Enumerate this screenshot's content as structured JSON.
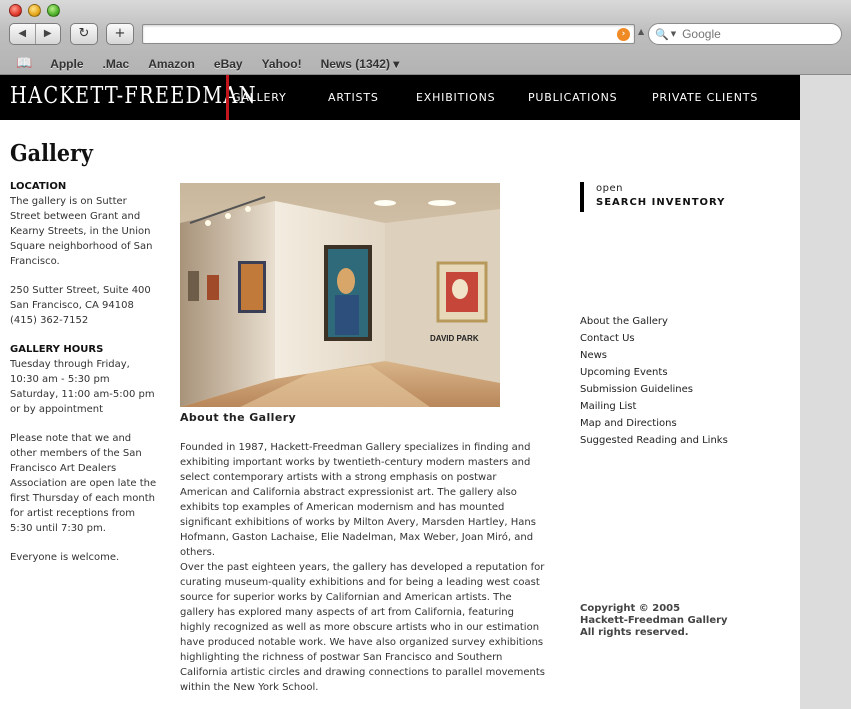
{
  "browser": {
    "bookmarks": [
      "Apple",
      ".Mac",
      "Amazon",
      "eBay",
      "Yahoo!",
      "News (1342) ▾"
    ],
    "search_placeholder": "Google",
    "url": ""
  },
  "site": {
    "logo": "HACKETT-FREEDMAN",
    "nav": [
      "GALLERY",
      "ARTISTS",
      "EXHIBITIONS",
      "PUBLICATIONS",
      "PRIVATE CLIENTS"
    ]
  },
  "page_title": "Gallery",
  "left": {
    "location_heading": "LOCATION",
    "location_text": "The gallery is on Sutter Street between Grant and Kearny Streets, in the Union Square neighborhood of San Francisco.",
    "address_line1": "250 Sutter Street, Suite 400",
    "address_line2": "San Francisco, CA 94108",
    "phone": "(415) 362-7152",
    "hours_heading": "GALLERY HOURS",
    "hours_line1": "Tuesday through Friday,",
    "hours_line2": "10:30 am - 5:30 pm",
    "hours_line3": "Saturday, 11:00 am-5:00 pm",
    "hours_line4": "or by appointment",
    "note": "Please note that we and other members of the San Francisco Art Dealers Association are open late the first Thursday of each month for artist receptions from 5:30 until 7:30 pm.",
    "welcome": "Everyone is welcome."
  },
  "photo": {
    "wall_text": "DAVID PARK"
  },
  "about": {
    "heading": "About the Gallery",
    "para1": "Founded in 1987, Hackett-Freedman Gallery specializes in finding and exhibiting important works by twentieth-century modern masters and select contemporary artists with a strong emphasis on postwar American and California abstract expressionist art. The gallery also exhibits top examples of American modernism and has mounted significant exhibitions of works by Milton Avery, Marsden Hartley, Hans Hofmann, Gaston Lachaise, Elie Nadelman, Max Weber, Joan Miró, and others.",
    "para2": "Over the past eighteen years, the gallery has developed a reputation for curating museum-quality exhibitions and for being a leading west coast source for superior works by Californian and American artists. The gallery has explored many aspects of art from California, featuring highly recognized as well as more obscure artists who in our estimation have produced notable work. We have also organized survey exhibitions highlighting the richness of postwar San Francisco and Southern California artistic circles and drawing connections to parallel movements within the New York School."
  },
  "inventory": {
    "small": "open",
    "big": "SEARCH INVENTORY"
  },
  "sidelinks": [
    "About the Gallery",
    "Contact Us",
    "News",
    "Upcoming Events",
    "Submission Guidelines",
    "Mailing List",
    "Map and Directions",
    "Suggested Reading and Links"
  ],
  "copyright": {
    "line1": "Copyright © 2005",
    "line2": "Hackett-Freedman Gallery",
    "line3": "All rights reserved."
  },
  "colors": {
    "header_bg": "#000000",
    "accent_red": "#c4161c",
    "right_pane": "#dcdcdc"
  }
}
